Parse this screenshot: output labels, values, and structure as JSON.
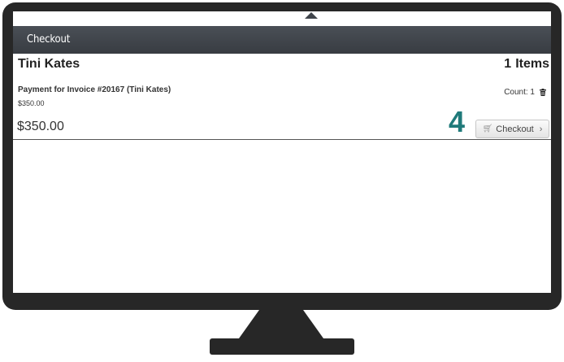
{
  "titlebar": {
    "title": "Checkout"
  },
  "cart": {
    "customer_name": "Tini Kates",
    "item_count": "1",
    "items_label": "Items",
    "line_items": [
      {
        "description": "Payment for Invoice #20167 (Tini Kates)",
        "price": "$350.00",
        "count_label": "Count: 1"
      }
    ],
    "total": "$350.00",
    "checkout_label": "Checkout"
  },
  "annotation": {
    "step_number": "4",
    "color": "#1f7a7a"
  },
  "icons": [
    "cart-icon",
    "trash-icon",
    "chevron-right-icon"
  ]
}
